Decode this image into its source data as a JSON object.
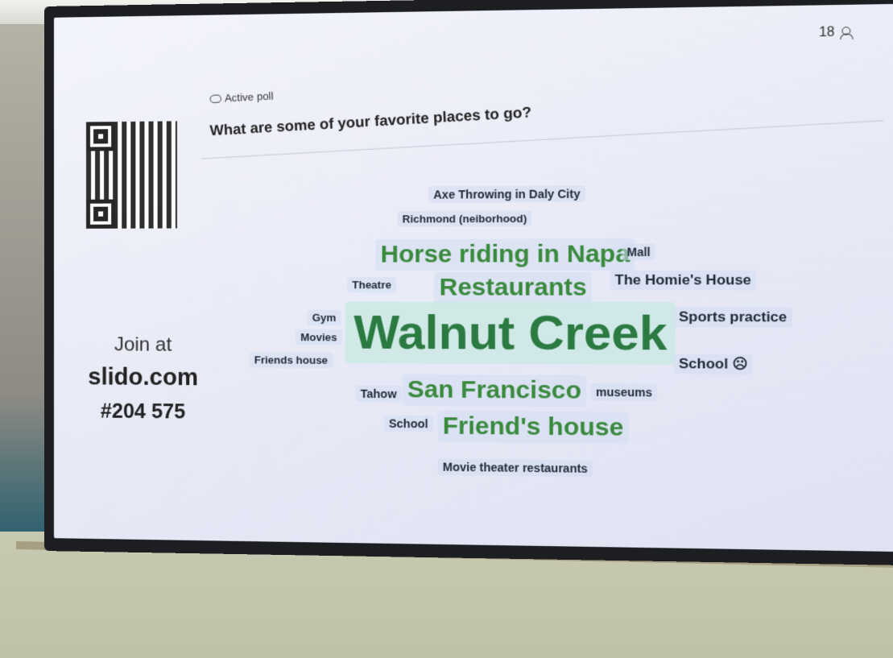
{
  "screen": {
    "participants": "18",
    "poll_status": "Active poll",
    "question": "What are some of your favorite places to go?",
    "join": {
      "label": "Join at",
      "url": "slido.com",
      "code": "#204 575"
    }
  },
  "word_cloud": [
    {
      "text": "Axe Throwing in Daly City"
    },
    {
      "text": "Richmond (neiborhood)"
    },
    {
      "text": "Horse riding in Napa"
    },
    {
      "text": "Mall"
    },
    {
      "text": "Theatre"
    },
    {
      "text": "Restaurants"
    },
    {
      "text": "The Homie's House"
    },
    {
      "text": "Gym"
    },
    {
      "text": "Movies"
    },
    {
      "text": "Walnut Creek"
    },
    {
      "text": "Sports practice"
    },
    {
      "text": "Friends house"
    },
    {
      "text": "School ☹"
    },
    {
      "text": "Tahow"
    },
    {
      "text": "San Francisco"
    },
    {
      "text": "museums"
    },
    {
      "text": "School"
    },
    {
      "text": "Friend's house"
    },
    {
      "text": "Movie theater restaurants"
    }
  ]
}
